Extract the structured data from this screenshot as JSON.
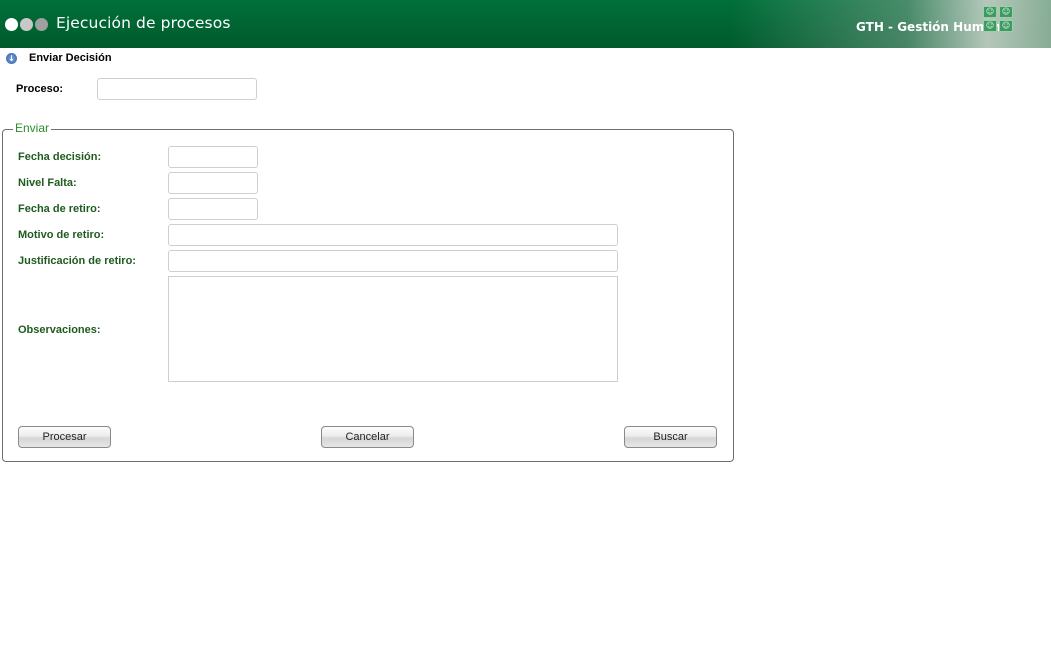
{
  "header": {
    "title": "Ejecución de procesos",
    "brand": "GTH - Gestión Humana",
    "dot_colors": [
      "#ffffff",
      "#c8c8c8",
      "#a0a0a0"
    ],
    "icons": [
      "people-grid-icon"
    ]
  },
  "section": {
    "title": "Enviar Decisión",
    "icon": "download-arrow-icon"
  },
  "proceso": {
    "label": "Proceso:",
    "value": ""
  },
  "enviar": {
    "legend": "Enviar",
    "fields": {
      "fecha_decision": {
        "label": "Fecha decisión:",
        "value": ""
      },
      "nivel_falta": {
        "label": "Nivel Falta:",
        "value": ""
      },
      "fecha_retiro": {
        "label": "Fecha de retiro:",
        "value": ""
      },
      "motivo_retiro": {
        "label": "Motivo de retiro:",
        "value": ""
      },
      "justificacion_retiro": {
        "label": "Justificación de retiro:",
        "value": ""
      },
      "observaciones": {
        "label": "Observaciones:",
        "value": ""
      }
    },
    "buttons": {
      "procesar": "Procesar",
      "cancelar": "Cancelar",
      "buscar": "Buscar"
    }
  },
  "colors": {
    "header_green": "#00703a",
    "label_green": "#1f5b1f",
    "legend_green": "#2e8b2e"
  }
}
